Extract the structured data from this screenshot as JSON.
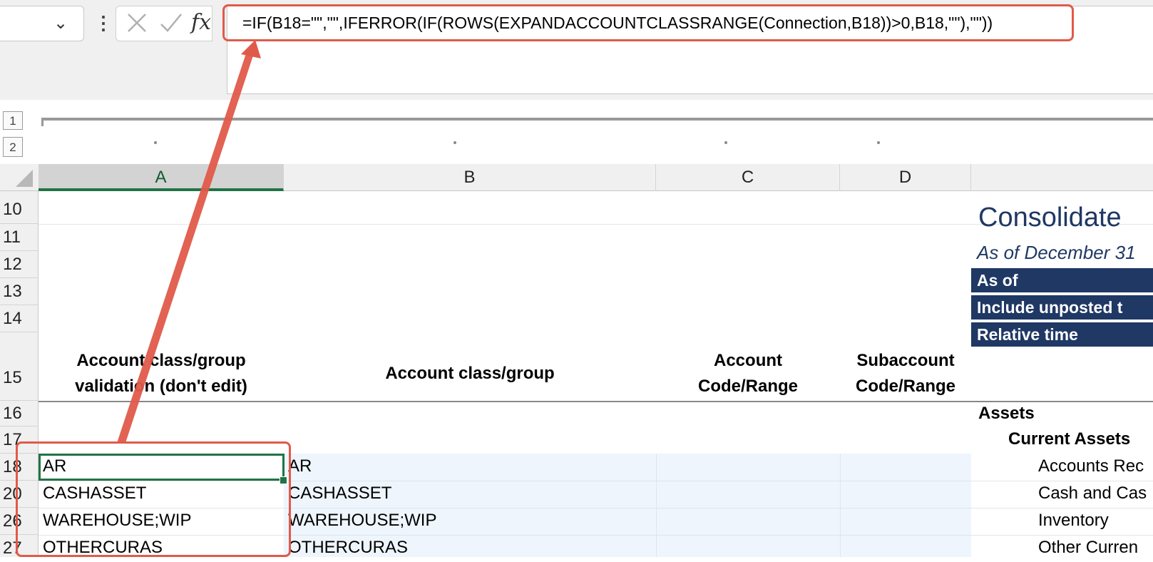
{
  "formula_bar": {
    "name_box_value": "",
    "fx_label": "fx",
    "formula": "=IF(B18=\"\",\"\",IFERROR(IF(ROWS(EXPANDACCOUNTCLASSRANGE(Connection,B18))>0,B18,\"\"),\"\"))"
  },
  "outline": {
    "level1": "1",
    "level2": "2"
  },
  "columns": {
    "A": "A",
    "B": "B",
    "C": "C",
    "D": "D"
  },
  "rows": {
    "r10": "10",
    "r11": "11",
    "r12": "12",
    "r13": "13",
    "r14": "14",
    "r15": "15",
    "r16": "16",
    "r17": "17",
    "r18": "18",
    "r20": "20",
    "r26": "26",
    "r27": "27"
  },
  "report": {
    "title": "Consolidate",
    "subtitle": "As of December 31",
    "as_of": "As of",
    "include_unposted": "Include unposted t",
    "relative_time": "Relative time"
  },
  "headers": {
    "col_a": {
      "line1": "Account class/group",
      "line2": "validation (don't edit)"
    },
    "col_b": "Account class/group",
    "col_c": {
      "line1": "Account",
      "line2": "Code/Range"
    },
    "col_d": {
      "line1": "Subaccount",
      "line2": "Code/Range"
    }
  },
  "data_rows": [
    {
      "a": "AR",
      "b": "AR",
      "label": "Accounts Rec"
    },
    {
      "a": "CASHASSET",
      "b": "CASHASSET",
      "label": "Cash and Cas"
    },
    {
      "a": "WAREHOUSE;WIP",
      "b": "WAREHOUSE;WIP",
      "label": "Inventory"
    },
    {
      "a": "OTHERCURAS",
      "b": "OTHERCURAS",
      "label": "Other Curren"
    }
  ],
  "sections": {
    "assets": "Assets",
    "current_assets": "Current Assets"
  },
  "colors": {
    "navy": "#1f3864",
    "excel_green": "#217346",
    "annotation_red": "#e05a4a"
  }
}
